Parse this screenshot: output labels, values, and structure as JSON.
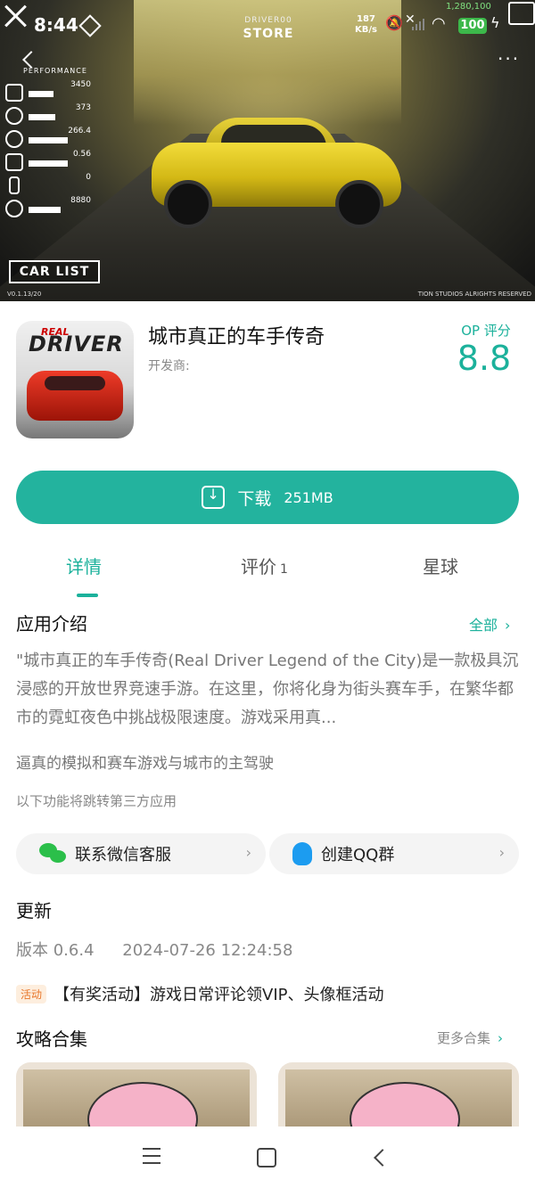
{
  "status_bar": {
    "time": "8:44",
    "net_speed_value": "187",
    "net_speed_unit": "KB/s",
    "battery": "100",
    "money": "1,280,100"
  },
  "hero": {
    "brand_small": "DRIVER00",
    "store_label": "STORE",
    "perf_title": "PERFORMANCE",
    "perf_values": [
      "3450",
      "373",
      "266.4",
      "0.56",
      "0",
      "8880"
    ],
    "car_list_button": "CAR LIST",
    "version": "V0.1.13/20",
    "copyright": "TION STUDIOS ALRIGHTS RESERVED"
  },
  "app": {
    "title": "城市真正的车手传奇",
    "developer_label": "开发商:",
    "rating_label": "OP 评分",
    "rating_value": "8.8",
    "icon_text": "DRIVER",
    "icon_sub": "REAL"
  },
  "download": {
    "label": "下载",
    "size": "251MB"
  },
  "tabs": [
    {
      "label": "详情"
    },
    {
      "label": "评价",
      "count": "1"
    },
    {
      "label": "星球"
    }
  ],
  "intro": {
    "title": "应用介绍",
    "all_link": "全部",
    "description": "\"城市真正的车手传奇(Real Driver Legend of the City)是一款极具沉浸感的开放世界竞速手游。在这里，你将化身为街头赛车手，在繁华都市的霓虹夜色中挑战极限速度。游戏采用真...",
    "tagline": "逼真的模拟和赛车游戏与城市的主驾驶",
    "third_party_note": "以下功能将跳转第三方应用"
  },
  "contacts": {
    "wechat": "联系微信客服",
    "qq": "创建QQ群"
  },
  "update": {
    "title": "更新",
    "version": "版本 0.6.4",
    "date": "2024-07-26 12:24:58",
    "promo_badge": "活动",
    "promo_text": "【有奖活动】游戏日常评论领VIP、头像框活动"
  },
  "guides": {
    "title": "攻略合集",
    "more_link": "更多合集"
  },
  "colors": {
    "accent": "#1bb19b",
    "download_bg": "#23b39e",
    "promo": "#e8762a"
  }
}
